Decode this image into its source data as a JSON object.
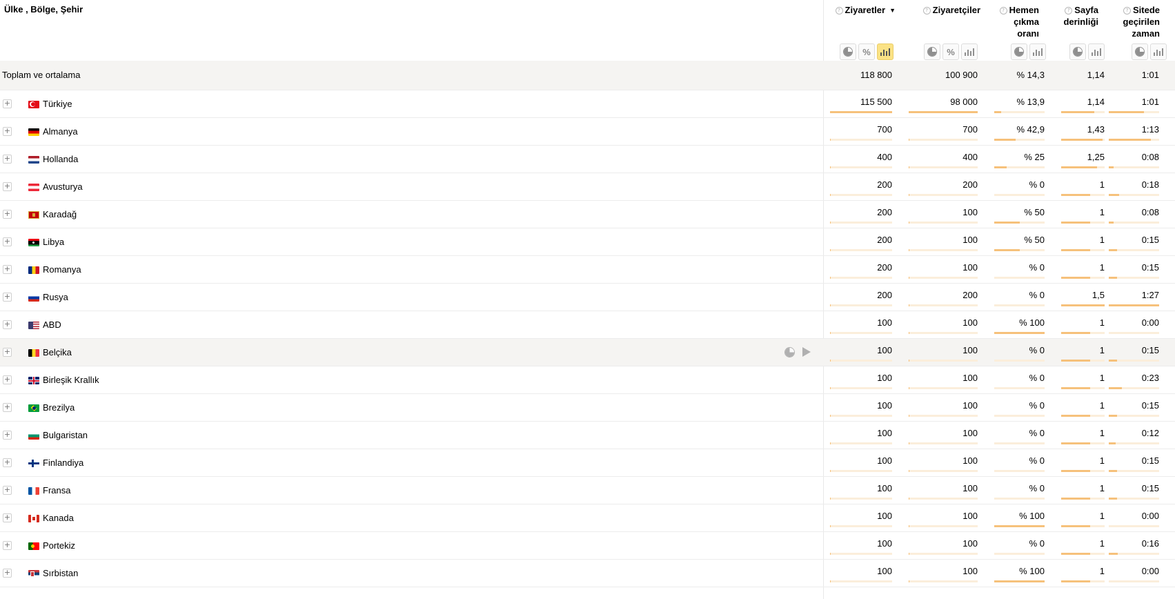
{
  "header": {
    "dimension_label": "Ülke , Bölge, Şehir",
    "columns": [
      {
        "key": "visits",
        "lines": [
          "Ziyaretler"
        ],
        "help": "?",
        "sorted": true,
        "sort_icon": "▼",
        "buttons": [
          "pie",
          "percent",
          "bars"
        ],
        "active_button": "bars"
      },
      {
        "key": "visitors",
        "lines": [
          "Ziyaretçiler"
        ],
        "help": "?",
        "buttons": [
          "pie",
          "percent",
          "bars"
        ]
      },
      {
        "key": "bounce",
        "lines": [
          "Hemen",
          "çıkma",
          "oranı"
        ],
        "help": "?",
        "buttons": [
          "pie",
          "bars"
        ]
      },
      {
        "key": "depth",
        "lines": [
          "Sayfa",
          "derinliği"
        ],
        "help": "?",
        "buttons": [
          "pie",
          "bars"
        ]
      },
      {
        "key": "time",
        "lines": [
          "Sitede",
          "geçirilen",
          "zaman"
        ],
        "help": "?",
        "buttons": [
          "pie",
          "bars"
        ]
      }
    ],
    "percent_symbol": "%"
  },
  "totals": {
    "label": "Toplam ve ortalama",
    "visits": "118 800",
    "visitors": "100 900",
    "bounce": "% 14,3",
    "depth": "1,14",
    "time": "1:01"
  },
  "rows": [
    {
      "country": "Türkiye",
      "flag": "tr",
      "visits": "115 500",
      "visitors": "98 000",
      "bounce": "% 13,9",
      "depth": "1,14",
      "time": "1:01",
      "bars": {
        "visits": 1,
        "visitors": 1,
        "bounce": 0.139,
        "depth": 0.76,
        "time": 0.7
      }
    },
    {
      "country": "Almanya",
      "flag": "de",
      "visits": "700",
      "visitors": "700",
      "bounce": "% 42,9",
      "depth": "1,43",
      "time": "1:13",
      "bars": {
        "visits": 0.006,
        "visitors": 0.007,
        "bounce": 0.429,
        "depth": 0.95,
        "time": 0.84
      }
    },
    {
      "country": "Hollanda",
      "flag": "nl",
      "visits": "400",
      "visitors": "400",
      "bounce": "% 25",
      "depth": "1,25",
      "time": "0:08",
      "bars": {
        "visits": 0.0035,
        "visitors": 0.004,
        "bounce": 0.25,
        "depth": 0.83,
        "time": 0.09
      }
    },
    {
      "country": "Avusturya",
      "flag": "at",
      "visits": "200",
      "visitors": "200",
      "bounce": "% 0",
      "depth": "1",
      "time": "0:18",
      "bars": {
        "visits": 0.0017,
        "visitors": 0.002,
        "bounce": 0,
        "depth": 0.67,
        "time": 0.21
      }
    },
    {
      "country": "Karadağ",
      "flag": "me",
      "visits": "200",
      "visitors": "100",
      "bounce": "% 50",
      "depth": "1",
      "time": "0:08",
      "bars": {
        "visits": 0.0017,
        "visitors": 0.001,
        "bounce": 0.5,
        "depth": 0.67,
        "time": 0.09
      }
    },
    {
      "country": "Libya",
      "flag": "ly",
      "visits": "200",
      "visitors": "100",
      "bounce": "% 50",
      "depth": "1",
      "time": "0:15",
      "bars": {
        "visits": 0.0017,
        "visitors": 0.001,
        "bounce": 0.5,
        "depth": 0.67,
        "time": 0.17
      }
    },
    {
      "country": "Romanya",
      "flag": "ro",
      "visits": "200",
      "visitors": "100",
      "bounce": "% 0",
      "depth": "1",
      "time": "0:15",
      "bars": {
        "visits": 0.0017,
        "visitors": 0.001,
        "bounce": 0,
        "depth": 0.67,
        "time": 0.17
      }
    },
    {
      "country": "Rusya",
      "flag": "ru",
      "visits": "200",
      "visitors": "200",
      "bounce": "% 0",
      "depth": "1,5",
      "time": "1:27",
      "bars": {
        "visits": 0.0017,
        "visitors": 0.002,
        "bounce": 0,
        "depth": 1,
        "time": 1
      }
    },
    {
      "country": "ABD",
      "flag": "us",
      "visits": "100",
      "visitors": "100",
      "bounce": "% 100",
      "depth": "1",
      "time": "0:00",
      "bars": {
        "visits": 0.0009,
        "visitors": 0.001,
        "bounce": 1,
        "depth": 0.67,
        "time": 0
      }
    },
    {
      "country": "Belçika",
      "flag": "be",
      "visits": "100",
      "visitors": "100",
      "bounce": "% 0",
      "depth": "1",
      "time": "0:15",
      "highlighted": true,
      "bars": {
        "visits": 0.0009,
        "visitors": 0.001,
        "bounce": 0,
        "depth": 0.67,
        "time": 0.17
      }
    },
    {
      "country": "Birleşik Krallık",
      "flag": "gb",
      "visits": "100",
      "visitors": "100",
      "bounce": "% 0",
      "depth": "1",
      "time": "0:23",
      "bars": {
        "visits": 0.0009,
        "visitors": 0.001,
        "bounce": 0,
        "depth": 0.67,
        "time": 0.26
      }
    },
    {
      "country": "Brezilya",
      "flag": "br",
      "visits": "100",
      "visitors": "100",
      "bounce": "% 0",
      "depth": "1",
      "time": "0:15",
      "bars": {
        "visits": 0.0009,
        "visitors": 0.001,
        "bounce": 0,
        "depth": 0.67,
        "time": 0.17
      }
    },
    {
      "country": "Bulgaristan",
      "flag": "bg",
      "visits": "100",
      "visitors": "100",
      "bounce": "% 0",
      "depth": "1",
      "time": "0:12",
      "bars": {
        "visits": 0.0009,
        "visitors": 0.001,
        "bounce": 0,
        "depth": 0.67,
        "time": 0.14
      }
    },
    {
      "country": "Finlandiya",
      "flag": "fi",
      "visits": "100",
      "visitors": "100",
      "bounce": "% 0",
      "depth": "1",
      "time": "0:15",
      "bars": {
        "visits": 0.0009,
        "visitors": 0.001,
        "bounce": 0,
        "depth": 0.67,
        "time": 0.17
      }
    },
    {
      "country": "Fransa",
      "flag": "fr",
      "visits": "100",
      "visitors": "100",
      "bounce": "% 0",
      "depth": "1",
      "time": "0:15",
      "bars": {
        "visits": 0.0009,
        "visitors": 0.001,
        "bounce": 0,
        "depth": 0.67,
        "time": 0.17
      }
    },
    {
      "country": "Kanada",
      "flag": "ca",
      "visits": "100",
      "visitors": "100",
      "bounce": "% 100",
      "depth": "1",
      "time": "0:00",
      "bars": {
        "visits": 0.0009,
        "visitors": 0.001,
        "bounce": 1,
        "depth": 0.67,
        "time": 0
      }
    },
    {
      "country": "Portekiz",
      "flag": "pt",
      "visits": "100",
      "visitors": "100",
      "bounce": "% 0",
      "depth": "1",
      "time": "0:16",
      "bars": {
        "visits": 0.0009,
        "visitors": 0.001,
        "bounce": 0,
        "depth": 0.67,
        "time": 0.18
      }
    },
    {
      "country": "Sırbistan",
      "flag": "rs",
      "visits": "100",
      "visitors": "100",
      "bounce": "% 100",
      "depth": "1",
      "time": "0:00",
      "bars": {
        "visits": 0.0009,
        "visitors": 0.001,
        "bounce": 1,
        "depth": 0.67,
        "time": 0
      }
    }
  ],
  "colors": {
    "bar_fill": "#f6c17b",
    "bar_track": "#fbeedb",
    "active_button": "#fbe285",
    "total_row_bg": "#f5f4f2"
  },
  "icons": {
    "expand": "plus-icon",
    "row_pie": "pie-chart-icon",
    "row_play": "play-icon",
    "help": "question-icon"
  }
}
